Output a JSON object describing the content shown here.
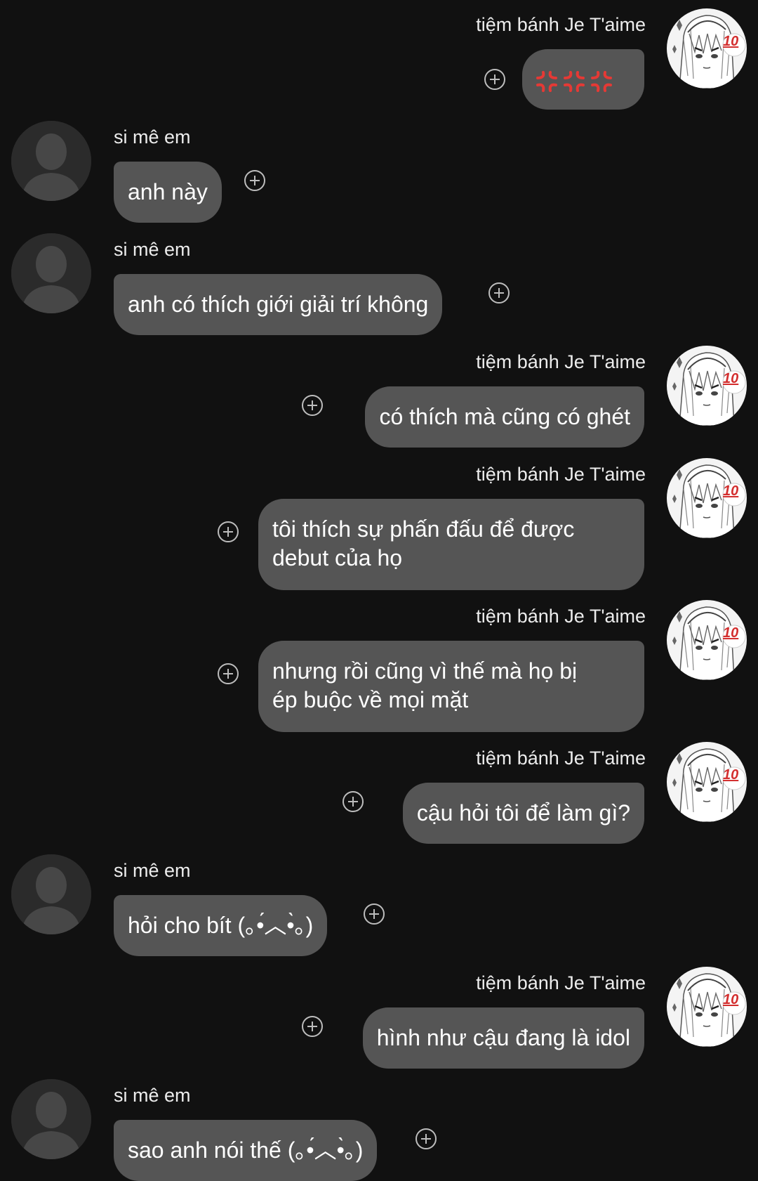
{
  "colors": {
    "background": "#111111",
    "bubble": "#555555",
    "text": "#ffffff",
    "name": "#ececec",
    "anger_emoji": "#e53935"
  },
  "participants": {
    "sender": {
      "name": "tiệm bánh Je T'aime",
      "avatar": "anime-character-avatar",
      "badge": "10"
    },
    "receiver": {
      "name": "si mê em",
      "avatar": "default-silhouette-avatar"
    }
  },
  "messages": [
    {
      "side": "out",
      "name": "tiệm bánh Je T'aime",
      "text": "",
      "emoji": "anger-symbol-emoji x3"
    },
    {
      "side": "in",
      "name": "si mê em",
      "text": "anh này"
    },
    {
      "side": "in",
      "name": "si mê em",
      "text": "anh có thích giới giải trí không"
    },
    {
      "side": "out",
      "name": "tiệm bánh Je T'aime",
      "text": "có thích mà cũng có ghét"
    },
    {
      "side": "out",
      "name": "tiệm bánh Je T'aime",
      "lines": [
        "tôi thích sự phấn đấu để được",
        "debut của họ"
      ]
    },
    {
      "side": "out",
      "name": "tiệm bánh Je T'aime",
      "lines": [
        "nhưng rồi cũng vì thế mà họ bị",
        "ép buộc về mọi mặt"
      ]
    },
    {
      "side": "out",
      "name": "tiệm bánh Je T'aime",
      "text": "cậu hỏi tôi để làm gì?"
    },
    {
      "side": "in",
      "name": "si mê em",
      "text": "hỏi cho bít (｡•́︿•̀｡)"
    },
    {
      "side": "out",
      "name": "tiệm bánh Je T'aime",
      "text": "hình như cậu đang là idol"
    },
    {
      "side": "in",
      "name": "si mê em",
      "text": "sao anh nói thế (｡•́︿•̀｡)"
    }
  ]
}
